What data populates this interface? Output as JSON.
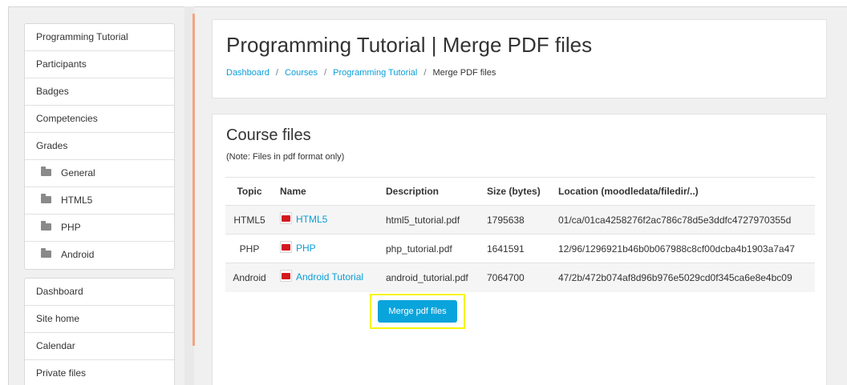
{
  "sidebar": {
    "course_items": [
      {
        "label": "Programming Tutorial"
      },
      {
        "label": "Participants"
      },
      {
        "label": "Badges"
      },
      {
        "label": "Competencies"
      },
      {
        "label": "Grades"
      },
      {
        "label": "General",
        "icon": "folder-icon"
      },
      {
        "label": "HTML5",
        "icon": "folder-icon"
      },
      {
        "label": "PHP",
        "icon": "folder-icon"
      },
      {
        "label": "Android",
        "icon": "folder-icon"
      }
    ],
    "site_items": [
      {
        "label": "Dashboard"
      },
      {
        "label": "Site home"
      },
      {
        "label": "Calendar"
      },
      {
        "label": "Private files"
      }
    ]
  },
  "header": {
    "title": "Programming Tutorial | Merge PDF files",
    "breadcrumb": [
      "Dashboard",
      "Courses",
      "Programming Tutorial",
      "Merge PDF files"
    ],
    "breadcrumb_separator": "/"
  },
  "main": {
    "section_title": "Course files",
    "note": "(Note: Files in pdf format only)",
    "columns": [
      "Topic",
      "Name",
      "Description",
      "Size (bytes)",
      "Location (moodledata/filedir/..)"
    ],
    "rows": [
      {
        "topic": "HTML5",
        "name": "HTML5",
        "description": "html5_tutorial.pdf",
        "size": "1795638",
        "location": "01/ca/01ca4258276f2ac786c78d5e3ddfc4727970355d"
      },
      {
        "topic": "PHP",
        "name": "PHP",
        "description": "php_tutorial.pdf",
        "size": "1641591",
        "location": "12/96/1296921b46b0b067988c8cf00dcba4b1903a7a47"
      },
      {
        "topic": "Android",
        "name": "Android Tutorial",
        "description": "android_tutorial.pdf",
        "size": "7064700",
        "location": "47/2b/472b074af8d96b976e5029cd0f345ca6e8e4bc09"
      }
    ],
    "merge_button_label": "Merge pdf files"
  },
  "colors": {
    "link": "#0a9ed8",
    "button": "#0aa4dc",
    "highlight": "#f5f50a",
    "accent_line": "#f1a481",
    "pdf_icon": "#d4181f"
  }
}
